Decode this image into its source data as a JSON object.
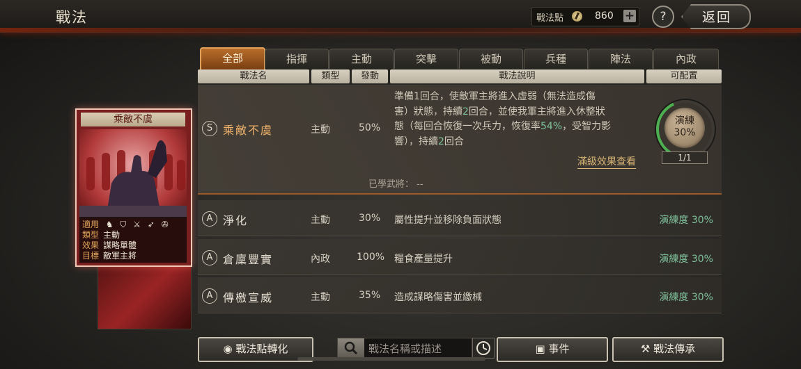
{
  "header": {
    "title": "戰法",
    "points_label": "戰法點",
    "points_value": "860",
    "plus": "+",
    "help": "?",
    "back_label": "返回"
  },
  "tabs": [
    "全部",
    "指揮",
    "主動",
    "突擊",
    "被動",
    "兵種",
    "陣法",
    "內政"
  ],
  "active_tab": 0,
  "columns": [
    "戰法名",
    "類型",
    "發動",
    "戰法說明",
    "可配置"
  ],
  "selected_skill": {
    "grade": "S",
    "name": "乘敵不虞",
    "type": "主動",
    "rate": "50%",
    "desc_lines": [
      [
        "準備1回合，使敵軍主將進入虛弱（無法造成傷"
      ],
      [
        "害）狀態，持續",
        "2",
        "回合，並使我軍主將進入休整狀"
      ],
      [
        "態（每回合恢復一次兵力，恢復率",
        "54%",
        "，受智力影"
      ],
      [
        "響），持續",
        "2",
        "回合"
      ]
    ],
    "full_effect_link": "滿級效果查看",
    "learned_label": "已學武將：",
    "learned_value": "--",
    "train_label": "演練",
    "train_pct": "30%",
    "train_count": "1/1"
  },
  "skills": [
    {
      "grade": "A",
      "name": "淨化",
      "type": "主動",
      "rate": "30%",
      "desc": "屬性提升並移除負面狀態",
      "mastery": "演練度 30%"
    },
    {
      "grade": "A",
      "name": "倉廩豐實",
      "type": "內政",
      "rate": "100%",
      "desc": "糧食產量提升",
      "mastery": "演練度 30%"
    },
    {
      "grade": "A",
      "name": "傳檄宣威",
      "type": "主動",
      "rate": "35%",
      "desc": "造成謀略傷害並繳械",
      "mastery": "演練度 30%"
    }
  ],
  "card": {
    "title": "乘敵不虞",
    "info": [
      {
        "key": "適用",
        "value": ""
      },
      {
        "key": "類型",
        "value": "主動"
      },
      {
        "key": "效果",
        "value": "謀略單體"
      },
      {
        "key": "目標",
        "value": "敵軍主將"
      }
    ]
  },
  "bottom": {
    "convert_label": "戰法點轉化",
    "search_placeholder": "戰法名稱或描述",
    "event_label": "事件",
    "inherit_label": "戰法傳承"
  },
  "colors": {
    "accent": "#e2a15a",
    "mastery_green": "#7fc29c",
    "highlight_name": "#f0b26b"
  }
}
